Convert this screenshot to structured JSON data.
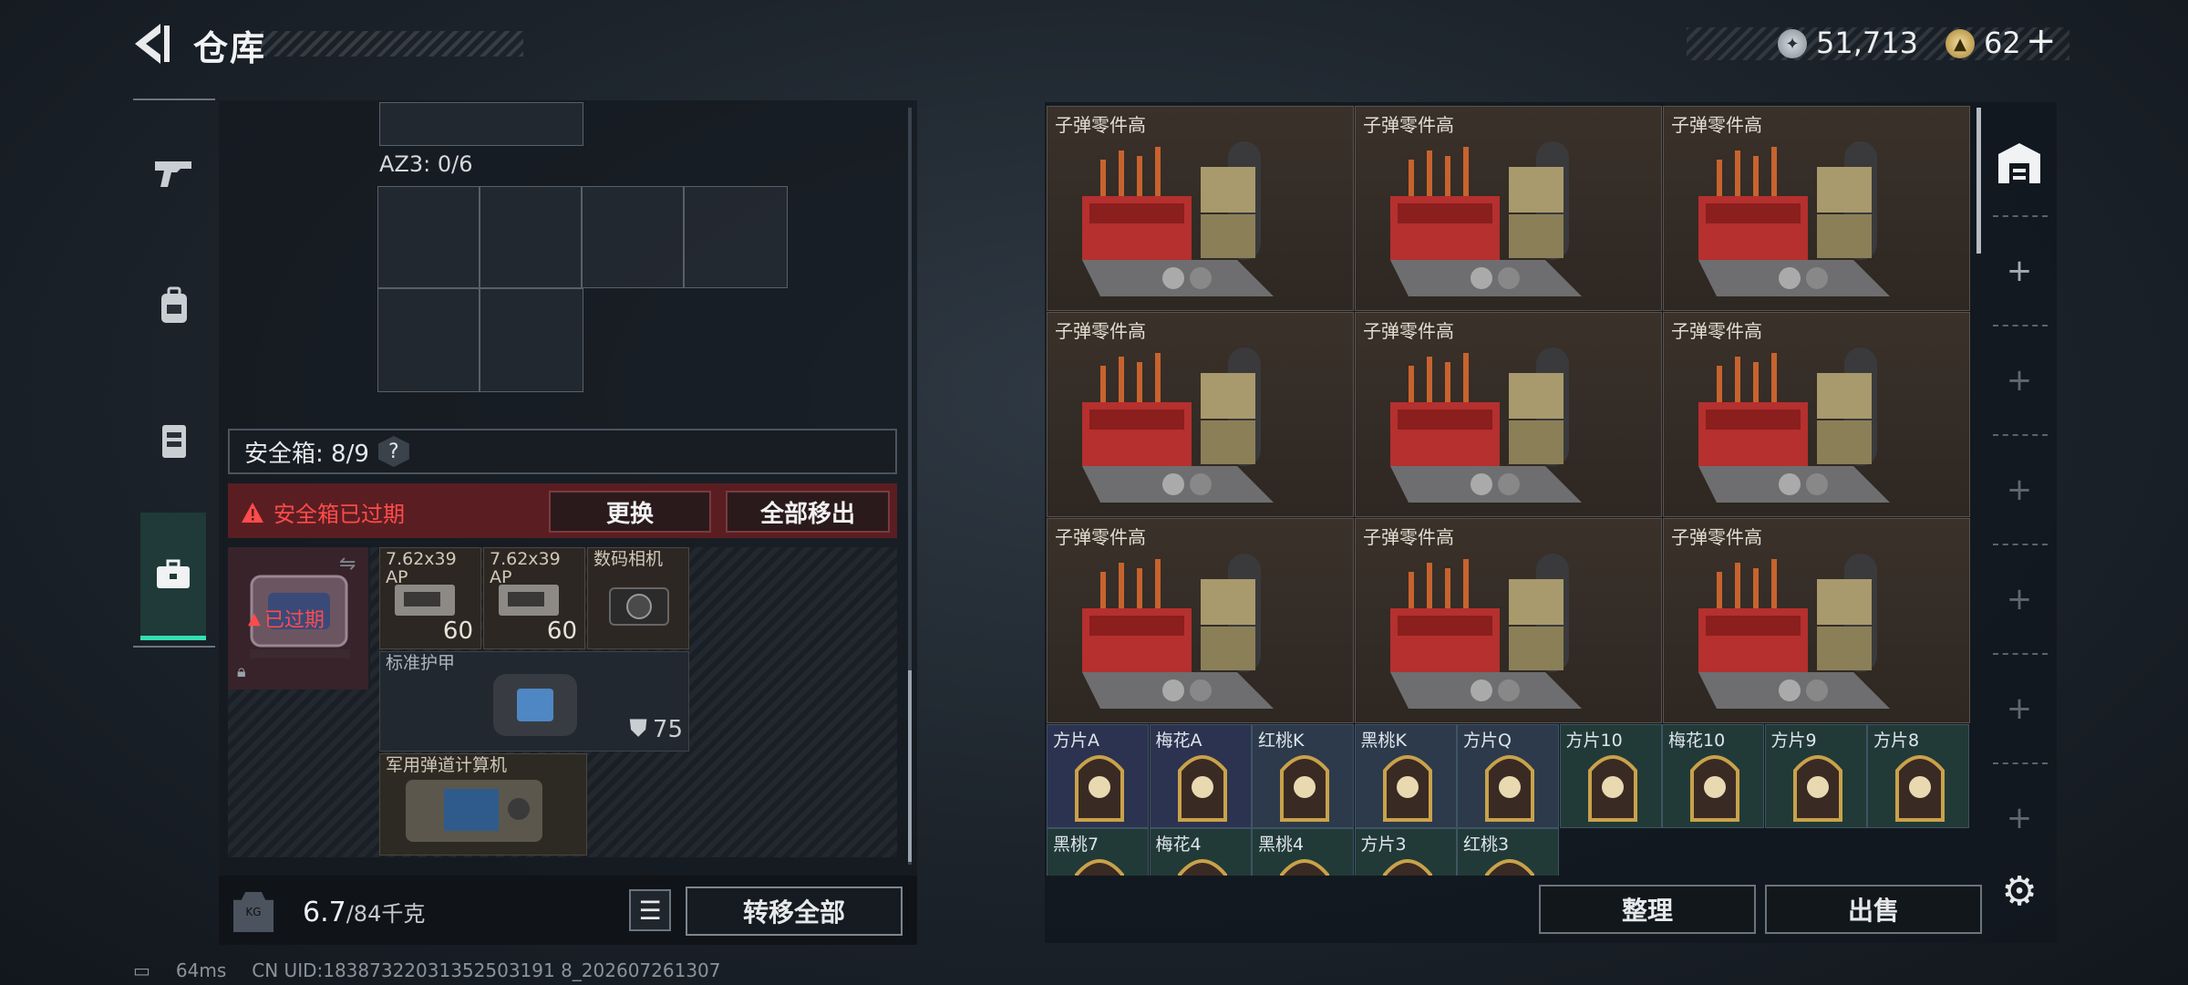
{
  "header": {
    "title": "仓库",
    "currency1_value": "51,713",
    "currency2_value": "62",
    "currency2_add": "+"
  },
  "left": {
    "az3_label": "AZ3: 0/6",
    "safe_label": "安全箱: 8/9",
    "help": "?",
    "expired_msg": "安全箱已过期",
    "replace_btn": "更换",
    "move_all_btn": "全部移出",
    "case_overlay": "已过期",
    "items": [
      {
        "label": "7.62x39\nAP",
        "count": "60"
      },
      {
        "label": "7.62x39\nAP",
        "count": "60"
      },
      {
        "label": "数码相机",
        "count": ""
      },
      {
        "label": "标准护甲",
        "count": "75"
      },
      {
        "label": "军用弹道计算机",
        "count": ""
      }
    ],
    "weight_value": "6.7",
    "weight_total": "/84千克",
    "transfer_all_btn": "转移全部"
  },
  "right": {
    "big_items": [
      "子弹零件高",
      "子弹零件高",
      "子弹零件高",
      "子弹零件高",
      "子弹零件高",
      "子弹零件高",
      "子弹零件高",
      "子弹零件高",
      "子弹零件高"
    ],
    "cards_row1": [
      "方片A",
      "梅花A",
      "红桃K",
      "黑桃K",
      "方片Q",
      "方片10",
      "梅花10",
      "方片9",
      "方片8"
    ],
    "cards_row2": [
      "黑桃7",
      "梅花4",
      "黑桃4",
      "方片3",
      "红桃3"
    ],
    "sort_btn": "整理",
    "sell_btn": "出售"
  },
  "status": {
    "ping": "64ms",
    "uid": "CN UID:18387322031352503191 8_202607261307"
  },
  "colors": {
    "accent": "#35e0b1",
    "warning": "#ff4b4b",
    "expired_bg": "#5a1e22"
  }
}
